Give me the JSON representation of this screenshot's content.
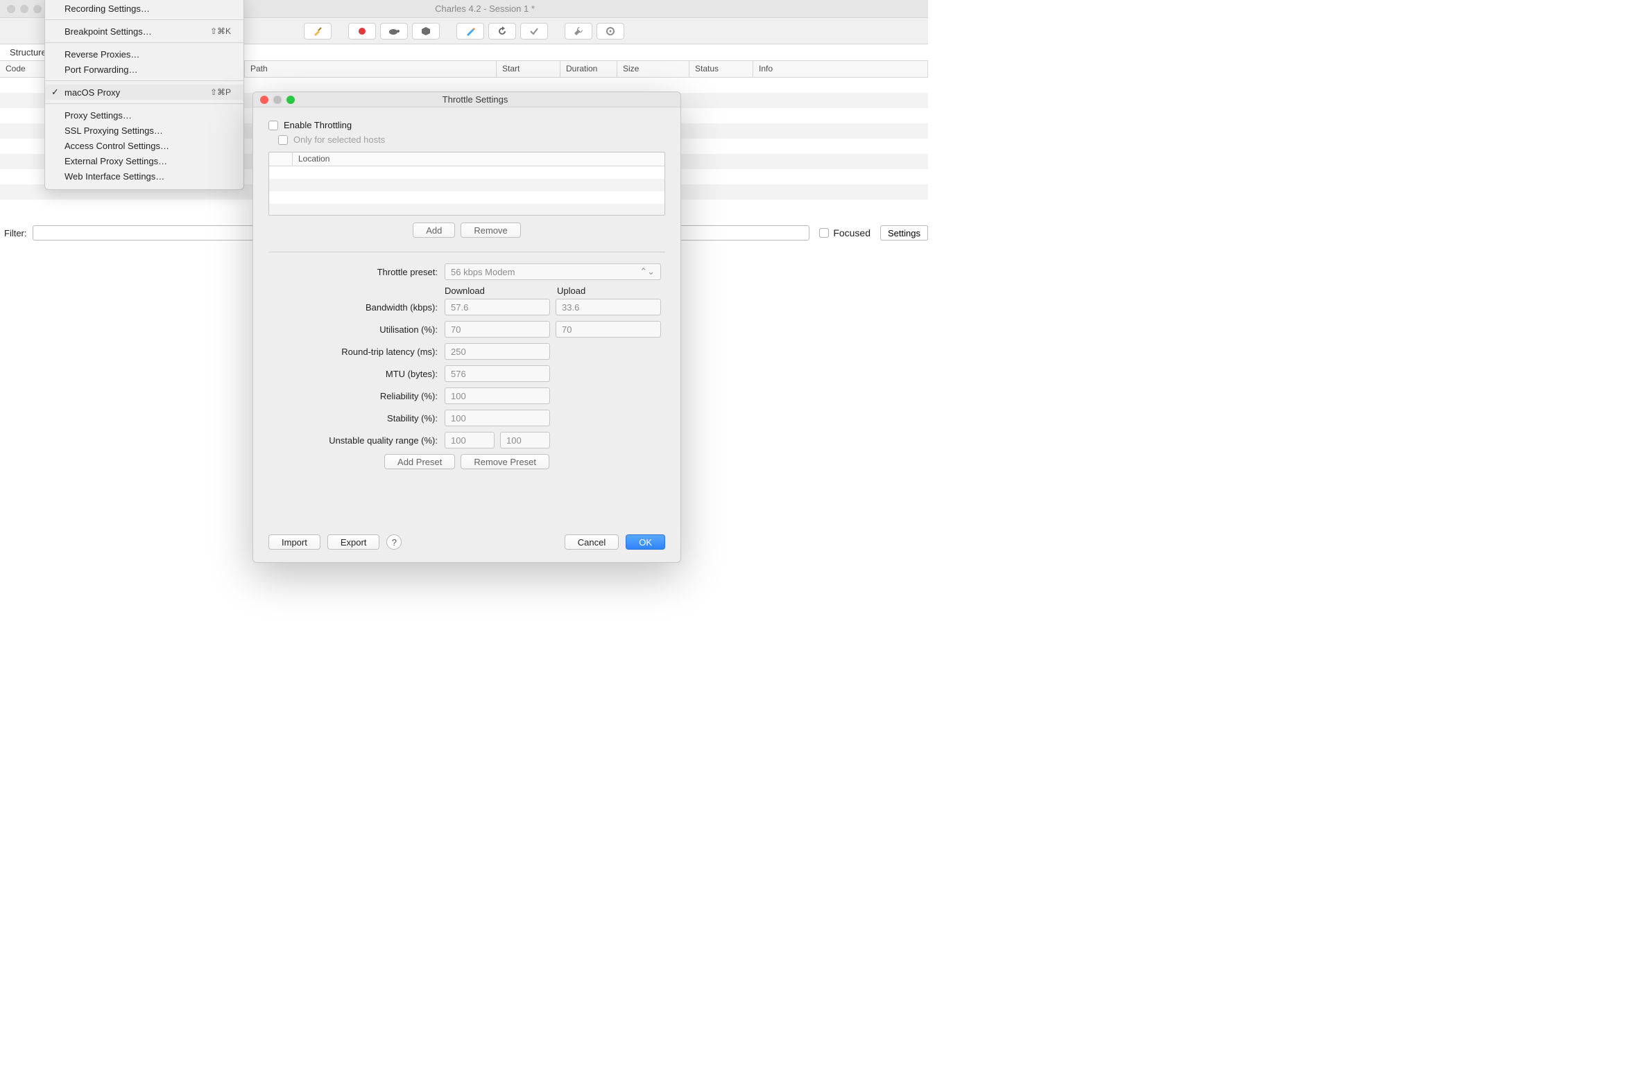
{
  "window": {
    "title": "Charles 4.2 - Session 1 *"
  },
  "toolbar_icons": [
    "broom",
    "record",
    "turtle",
    "hex",
    "pencil",
    "refresh",
    "check",
    "wrench",
    "gear"
  ],
  "left_tab": "Structure",
  "table_columns": {
    "code": "Code",
    "path": "Path",
    "start": "Start",
    "duration": "Duration",
    "size": "Size",
    "status": "Status",
    "info": "Info"
  },
  "filter": {
    "label": "Filter:",
    "value": "",
    "focused": "Focused",
    "settings": "Settings"
  },
  "menu": {
    "items": [
      {
        "label": "Recording Settings…",
        "shortcut": ""
      },
      {
        "sep": true
      },
      {
        "label": "Breakpoint Settings…",
        "shortcut": "⇧⌘K"
      },
      {
        "sep": true
      },
      {
        "label": "Reverse Proxies…",
        "shortcut": ""
      },
      {
        "label": "Port Forwarding…",
        "shortcut": ""
      },
      {
        "sep": true
      },
      {
        "label": "macOS Proxy",
        "shortcut": "⇧⌘P",
        "checked": true,
        "highlight": true
      },
      {
        "sep": true
      },
      {
        "label": "Proxy Settings…",
        "shortcut": ""
      },
      {
        "label": "SSL Proxying Settings…",
        "shortcut": ""
      },
      {
        "label": "Access Control Settings…",
        "shortcut": ""
      },
      {
        "label": "External Proxy Settings…",
        "shortcut": ""
      },
      {
        "label": "Web Interface Settings…",
        "shortcut": ""
      }
    ]
  },
  "dialog": {
    "title": "Throttle Settings",
    "enable": "Enable Throttling",
    "only_selected": "Only for selected hosts",
    "location_header": "Location",
    "add": "Add",
    "remove": "Remove",
    "preset_label": "Throttle preset:",
    "preset_value": "56 kbps Modem",
    "download": "Download",
    "upload": "Upload",
    "rows": {
      "bandwidth": {
        "label": "Bandwidth (kbps):",
        "dl": "57.6",
        "ul": "33.6"
      },
      "utilisation": {
        "label": "Utilisation (%):",
        "dl": "70",
        "ul": "70"
      },
      "latency": {
        "label": "Round-trip latency (ms):",
        "v": "250"
      },
      "mtu": {
        "label": "MTU (bytes):",
        "v": "576"
      },
      "reliability": {
        "label": "Reliability (%):",
        "v": "100"
      },
      "stability": {
        "label": "Stability (%):",
        "v": "100"
      },
      "unstable": {
        "label": "Unstable quality range (%):",
        "a": "100",
        "b": "100"
      }
    },
    "add_preset": "Add Preset",
    "remove_preset": "Remove Preset",
    "import": "Import",
    "export": "Export",
    "help": "?",
    "cancel": "Cancel",
    "ok": "OK"
  }
}
